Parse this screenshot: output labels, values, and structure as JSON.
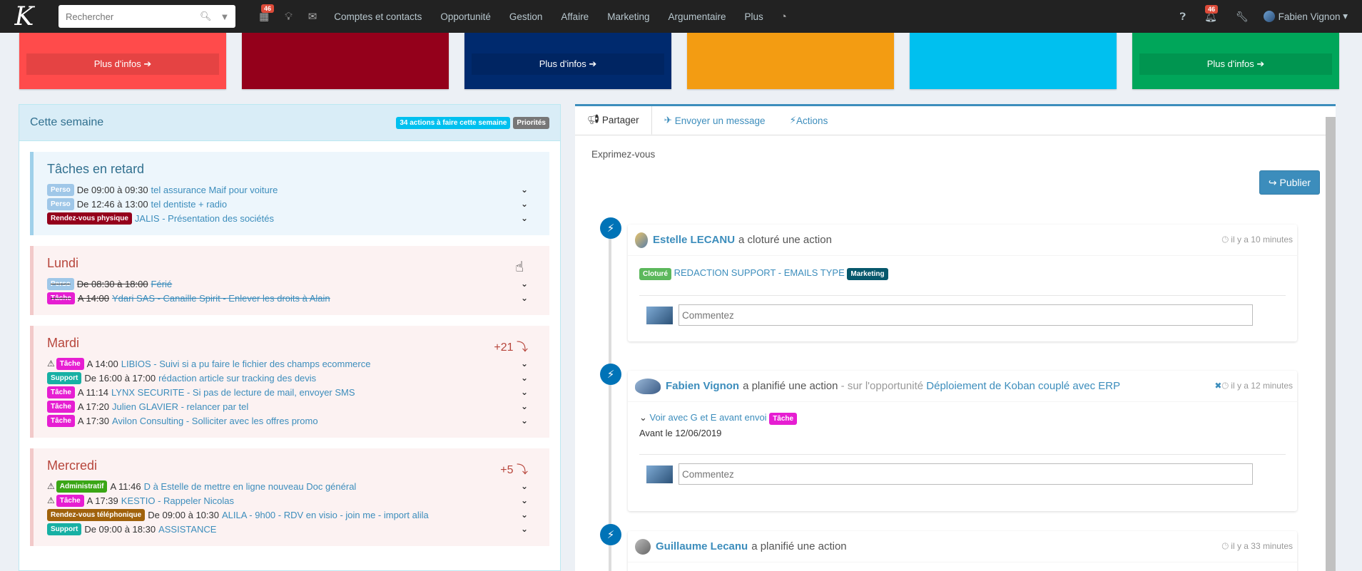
{
  "topbar": {
    "logo": "K",
    "search_placeholder": "Rechercher",
    "calendar_badge": "46",
    "nav": [
      "Comptes et contacts",
      "Opportunité",
      "Gestion",
      "Affaire",
      "Marketing",
      "Argumentaire",
      "Plus"
    ],
    "notif_badge": "46",
    "user_name": "Fabien Vignon"
  },
  "boxes": [
    {
      "color": "#ff4b4b",
      "more": "Plus d'infos ➔"
    },
    {
      "color": "#94001b",
      "more": ""
    },
    {
      "color": "#002a6e",
      "more": "Plus d'infos ➔"
    },
    {
      "color": "#f39c12",
      "more": ""
    },
    {
      "color": "#00c0ef",
      "more": ""
    },
    {
      "color": "#00a65a",
      "more": "Plus d'infos ➔"
    }
  ],
  "week": {
    "title": "Cette semaine",
    "actions_badge": "34 actions à faire cette semaine",
    "priorites_badge": "Priorités",
    "retard": {
      "title": "Tâches en retard",
      "items": [
        {
          "label": "Perso",
          "color": "#9fc7e8",
          "time": "De 09:00 à 09:30",
          "link": "tel assurance Maif pour voiture"
        },
        {
          "label": "Perso",
          "color": "#9fc7e8",
          "time": "De 12:46 à 13:00",
          "link": "tel dentiste + radio"
        },
        {
          "label": "Rendez-vous physique",
          "color": "#94001b",
          "time": "",
          "link": "JALIS - Présentation des sociétés"
        }
      ]
    },
    "lundi": {
      "title": "Lundi",
      "items": [
        {
          "label": "Perso",
          "color": "#9fc7e8",
          "time": "De 08:30 à 18:00",
          "link": "Férié"
        },
        {
          "label": "Tâche",
          "color": "#e61ed2",
          "time": "A 14:00",
          "link": "Ydari SAS - Canaille Spirit - Enlever les droits à Alain"
        }
      ]
    },
    "mardi": {
      "title": "Mardi",
      "extra": "+21 ⤵",
      "items": [
        {
          "warn": "⚠",
          "label": "Tâche",
          "color": "#e61ed2",
          "time": "A 14:00",
          "link": "LIBIOS - Suivi si a pu faire le fichier des champs ecommerce"
        },
        {
          "warn": "",
          "label": "Support",
          "color": "#17b0a4",
          "time": "De 16:00 à 17:00",
          "link": "rédaction article sur tracking des devis"
        },
        {
          "warn": "",
          "label": "Tâche",
          "color": "#e61ed2",
          "time": "A 11:14",
          "link": "LYNX SECURITE - Si pas de lecture de mail, envoyer SMS"
        },
        {
          "warn": "",
          "label": "Tâche",
          "color": "#e61ed2",
          "time": "A 17:20",
          "link": "Julien GLAVIER - relancer par tel"
        },
        {
          "warn": "",
          "label": "Tâche",
          "color": "#e61ed2",
          "time": "A 17:30",
          "link": "Avilon Consulting - Solliciter avec les offres promo"
        }
      ]
    },
    "mercredi": {
      "title": "Mercredi",
      "extra": "+5 ⤵",
      "items": [
        {
          "warn": "⚠",
          "label": "Administratif",
          "color": "#3aa615",
          "time": "A 11:46",
          "link": "D à Estelle de mettre en ligne nouveau Doc général"
        },
        {
          "warn": "⚠",
          "label": "Tâche",
          "color": "#e61ed2",
          "time": "A 17:39",
          "link": "KESTIO - Rappeler Nicolas"
        },
        {
          "warn": "",
          "label": "Rendez-vous téléphonique",
          "color": "#a0620c",
          "time": "De 09:00 à 10:30",
          "link": "ALILA - 9h00 - RDV en visio - join me - import alila"
        },
        {
          "warn": "",
          "label": "Support",
          "color": "#17b0a4",
          "time": "De 09:00 à 18:30",
          "link": "ASSISTANCE"
        }
      ]
    }
  },
  "share": {
    "tabs": [
      "Partager",
      "Envoyer un message",
      "Actions"
    ],
    "express": "Exprimez-vous",
    "publish": "Publier",
    "comment_placeholder": "Commentez",
    "items": [
      {
        "user": "Estelle LECANU",
        "verb": "a cloturé une action",
        "time": "il y a 10 minutes",
        "status": "Cloturé",
        "title": "REDACTION SUPPORT - EMAILS TYPE",
        "tag": "Marketing"
      },
      {
        "user": "Fabien Vignon",
        "verb": "a planifié une action",
        "context": "- sur l'opportunité",
        "opp": "Déploiement de Koban couplé avec ERP",
        "time": "il y a 12 minutes",
        "action": "Voir avec G et E avant envoi",
        "tag": "Tâche",
        "due": "Avant le 12/06/2019"
      },
      {
        "user": "Guillaume Lecanu",
        "verb": "a planifié une action",
        "time": "il y a 33 minutes"
      }
    ]
  }
}
